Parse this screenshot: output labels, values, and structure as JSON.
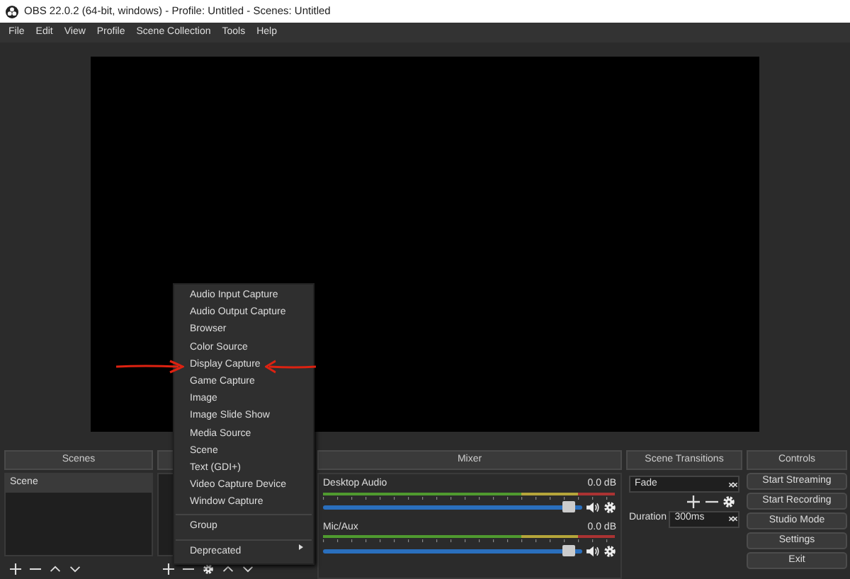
{
  "window": {
    "title": "OBS 22.0.2 (64-bit, windows) - Profile: Untitled - Scenes: Untitled"
  },
  "menu_bar": [
    "File",
    "Edit",
    "View",
    "Profile",
    "Scene Collection",
    "Tools",
    "Help"
  ],
  "scenes": {
    "title": "Scenes",
    "items": [
      {
        "label": "Scene",
        "selected": true
      }
    ]
  },
  "mixer": {
    "title": "Mixer",
    "channels": [
      {
        "name": "Desktop Audio",
        "reading": "0.0 dB",
        "level": 0.97
      },
      {
        "name": "Mic/Aux",
        "reading": "0.0 dB",
        "level": 0.97
      }
    ]
  },
  "scene_transitions": {
    "title": "Scene Transitions",
    "transition": "Fade",
    "duration_label": "Duration",
    "duration": "300ms"
  },
  "controls": {
    "title": "Controls",
    "buttons": [
      "Start Streaming",
      "Start Recording",
      "Studio Mode",
      "Settings",
      "Exit"
    ]
  },
  "context_menu": {
    "sections": [
      [
        {
          "label": "Audio Input Capture",
          "highlighted": false,
          "submenu": false
        },
        {
          "label": "Audio Output Capture",
          "highlighted": false,
          "submenu": false
        },
        {
          "label": "Browser",
          "highlighted": false,
          "submenu": false
        },
        {
          "label": "Color Source",
          "highlighted": false,
          "submenu": false
        },
        {
          "label": "Display Capture",
          "highlighted": true,
          "submenu": false
        },
        {
          "label": "Game Capture",
          "highlighted": false,
          "submenu": false
        },
        {
          "label": "Image",
          "highlighted": false,
          "submenu": false
        },
        {
          "label": "Image Slide Show",
          "highlighted": false,
          "submenu": false
        },
        {
          "label": "Media Source",
          "highlighted": false,
          "submenu": false
        },
        {
          "label": "Scene",
          "highlighted": false,
          "submenu": false
        },
        {
          "label": "Text (GDI+)",
          "highlighted": false,
          "submenu": false
        },
        {
          "label": "Video Capture Device",
          "highlighted": false,
          "submenu": false
        },
        {
          "label": "Window Capture",
          "highlighted": false,
          "submenu": false
        }
      ],
      [
        {
          "label": "Group",
          "highlighted": false,
          "submenu": false
        }
      ],
      [
        {
          "label": "Deprecated",
          "highlighted": false,
          "submenu": true
        }
      ]
    ]
  }
}
